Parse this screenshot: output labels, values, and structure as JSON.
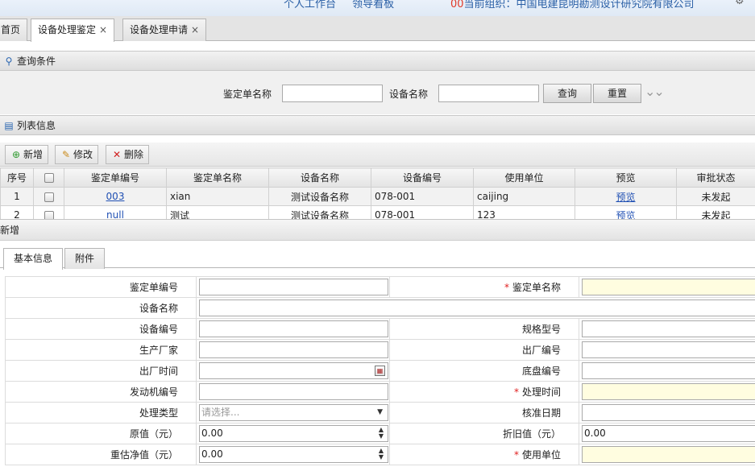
{
  "topbar": {
    "nav": [
      "个人工作台",
      "领导看板"
    ],
    "org_prefix": "00",
    "org_text": "当前组织：中国电建昆明勘测设计研究院有限公司",
    "right_icon": "settings-icon"
  },
  "tabs": [
    {
      "label": "首页"
    },
    {
      "label": "设备处理鉴定",
      "close": "×"
    },
    {
      "label": "设备处理申请",
      "close": "×"
    }
  ],
  "query": {
    "title": "查询条件",
    "label_form_name": "鉴定单名称",
    "label_device_name": "设备名称",
    "btn_search": "查询",
    "btn_reset": "重置",
    "expand_glyph": "⌄⌄"
  },
  "list": {
    "title": "列表信息",
    "btn_add": "新增",
    "btn_edit": "修改",
    "btn_delete": "删除",
    "columns": [
      "序号",
      "",
      "鉴定单编号",
      "鉴定单名称",
      "设备名称",
      "设备编号",
      "使用单位",
      "预览",
      "审批状态"
    ],
    "rows": [
      {
        "no": "1",
        "code": "003",
        "name": "xian",
        "device": "测试设备名称",
        "device_no": "078-001",
        "unit": "caijing",
        "preview": "预览",
        "status": "未发起"
      },
      {
        "no": "2",
        "code": "null",
        "name": "测试",
        "device": "测试设备名称",
        "device_no": "078-001",
        "unit": "123",
        "preview": "预览",
        "status": "未发起"
      }
    ]
  },
  "add_panel": {
    "title": "新增",
    "tab_basic": "基本信息",
    "tab_attach": "附件"
  },
  "form": {
    "form_code": "鉴定单编号",
    "form_name": "鉴定单名称",
    "device_name": "设备名称",
    "device_no": "设备编号",
    "spec_model": "规格型号",
    "manufacturer": "生产厂家",
    "factory_no": "出厂编号",
    "factory_time": "出厂时间",
    "chassis_no": "底盘编号",
    "engine_no": "发动机编号",
    "process_time": "处理时间",
    "process_type": "处理类型",
    "process_type_placeholder": "请选择...",
    "approve_date": "核准日期",
    "original_value": "原值（元）",
    "original_value_val": "0.00",
    "depreciation_value": "折旧值（元）",
    "depreciation_value_val": "0.00",
    "reassess_value": "重估净值（元）",
    "reassess_value_val": "0.00",
    "use_unit": "使用单位",
    "required_mark": "*"
  }
}
